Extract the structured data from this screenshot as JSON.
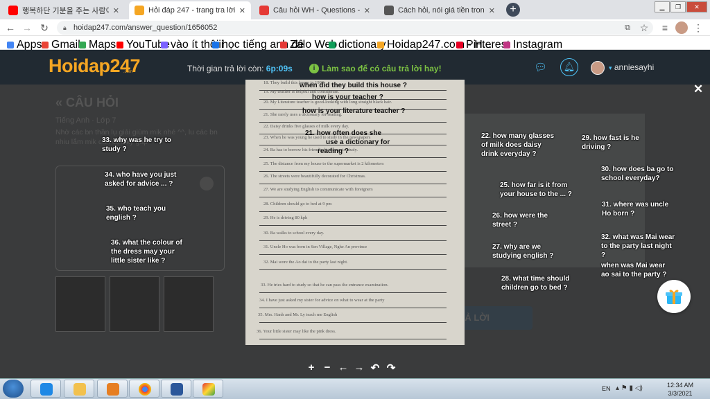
{
  "browser": {
    "tabs": [
      {
        "title": "행복하단 기분을 주는 사람이 너무",
        "icon": "youtube-icon",
        "color": "#ff0000",
        "active": false
      },
      {
        "title": "Hỏi đáp 247 - trang tra lời",
        "icon": "hoidap-icon",
        "color": "#f5a623",
        "active": true
      },
      {
        "title": "Câu hỏi WH - Questions - Aland",
        "icon": "aland-icon",
        "color": "#e53935",
        "active": false
      },
      {
        "title": "Cách hỏi, nói giá tiền trong Tiếng",
        "icon": "globe-icon",
        "color": "#555555",
        "active": false
      }
    ],
    "url": "hoidap247.com/answer_question/1656052",
    "bookmarks": [
      {
        "label": "Apps",
        "color": "#4285f4"
      },
      {
        "label": "Gmail",
        "color": "#ea4335"
      },
      {
        "label": "Maps",
        "color": "#34a853"
      },
      {
        "label": "YouTube",
        "color": "#ff0000"
      },
      {
        "label": "vào ít thôiii",
        "color": "#7b61ff"
      },
      {
        "label": "học tiếng anh đê",
        "color": "#1a73e8"
      },
      {
        "label": "Zalo Web",
        "color": "#e53935"
      },
      {
        "label": "dictionary",
        "color": "#0f9d58"
      },
      {
        "label": "Hoidap247.com - H...",
        "color": "#f5a623"
      },
      {
        "label": "Pinterest",
        "color": "#e60023"
      },
      {
        "label": "Instagram",
        "color": "#c13584"
      }
    ]
  },
  "site": {
    "logo_main": "Hoidap247",
    "logo_sub": ".com",
    "timer_label": "Thời gian trả lời còn:",
    "timer_value": "6p:09s",
    "hint": "Làm sao để có câu trả lời hay!",
    "username": "anniesayhi",
    "section_title": "« CÂU HỎI",
    "subject": "Tiếng Anh · Lớp 7",
    "question_text": "Nhờ các bn thần lụ giải giùm mik nhé ^^, lu các bn nhiu lắm mik cần cực kỳ gấp",
    "answer_button": "Ả LỜI"
  },
  "worksheet_lines": [
    "18. They build this house in 1990.",
    "19. My teacher is helpful and considerate.",
    "20. My Literature teacher is good-looking with long straight black hair.",
    "21. She rarely uses a dictionary for reading.",
    "22. Daisy drinks five glasses of milk every day.",
    "23. When he was young he used to study in the newspapers",
    "24. Ba has to borrow his friend's dictionary to study.",
    "25. The distance from my house to the supermarket is 2 kilometers",
    "26. The streets were beautifully decorated for Christmas.",
    "27. We are studying English to communicate with foreigners",
    "28. Children should go to bed at 9 pm",
    "29. He is driving 80 kph",
    "30. Ba walks to school every day.",
    "31. Uncle Ho was born in Sen Village, Nghe An province",
    "32. Mai wore the Ao dai to the party last night.",
    "33. He tries hard to study so that he can pass the entrance examination.",
    "34. I have just asked my sister for advice on what to wear at the party",
    "35. Mrs. Hanh and Mr. Ly teach me English",
    "36. Your little sister may like the pink dress."
  ],
  "annotations": {
    "a18": "when did they build this house ?",
    "a19": "how is your teacher ?",
    "a20": "how is your literature teacher ?",
    "a21a": "21. how often does she",
    "a21b": "use a dictionary for",
    "a21c": "reading ?",
    "a22": [
      "22. how many glasses",
      "of milk does daisy",
      "drink everyday ?"
    ],
    "a25": [
      "25. how far is it from",
      "your house to the ... ?"
    ],
    "a26": [
      "26. how were the",
      "street ?"
    ],
    "a27": [
      "27. why are we",
      "studying english ?"
    ],
    "a28": [
      "28. what time should",
      "children go to bed ?"
    ],
    "a29": [
      "29. how fast is he",
      "driving ?"
    ],
    "a30": [
      "30. how does ba go to",
      "school everyday?"
    ],
    "a31": [
      "31. where was uncle",
      "Ho born ?"
    ],
    "a32": [
      "32. what was Mai wear",
      "to the party last night",
      "?"
    ],
    "a32b": [
      "when was Mai wear",
      "ao sai to the party ?"
    ],
    "a33": [
      "33. why was he try to",
      "study ?"
    ],
    "a34": [
      "34. who have you just",
      "asked for advice ... ?"
    ],
    "a35": [
      "35. who teach you",
      "english ?"
    ],
    "a36": [
      "36. what the colour of",
      "the dress may your",
      "little sister like ?"
    ]
  },
  "viewer_toolbar": [
    "+",
    "−",
    "←",
    "→",
    "↶",
    "↷"
  ],
  "taskbar": {
    "lang": "EN",
    "time": "12:34 AM",
    "date": "3/3/2021"
  }
}
